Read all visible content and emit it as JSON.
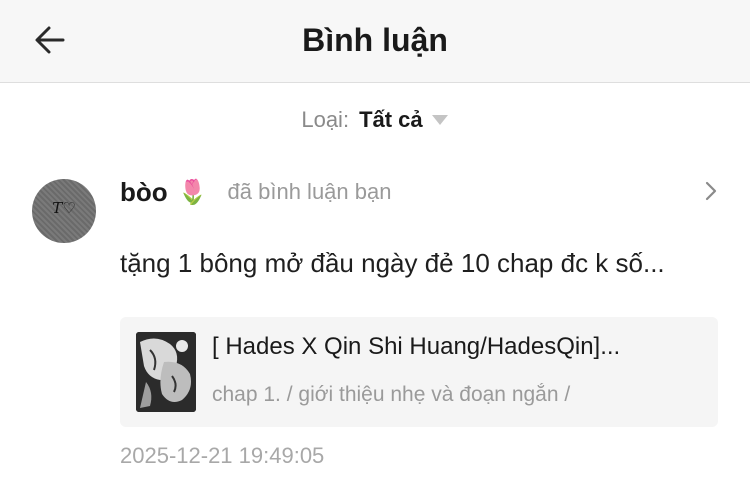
{
  "header": {
    "title": "Bình luận",
    "back_icon": "arrow-left-icon"
  },
  "filter": {
    "label": "Loại:",
    "value": "Tất cả",
    "icon": "caret-down-icon"
  },
  "comment": {
    "avatar_text": "T♡",
    "username": "bòo",
    "username_emoji": "🌷",
    "action": "đã bình luận bạn",
    "text": "tặng 1 bông mở đầu ngày đẻ 10 chap đc k số...",
    "story": {
      "title": "[ Hades X Qin Shi Huang/HadesQin]...",
      "chapter": "chap 1. / giới thiệu nhẹ và đoạn ngắn /"
    },
    "timestamp": "2025-12-21 19:49:05"
  },
  "colors": {
    "header_bg": "#f7f7f7",
    "card_bg": "#f5f5f5",
    "muted_text": "#9a9a9a"
  }
}
